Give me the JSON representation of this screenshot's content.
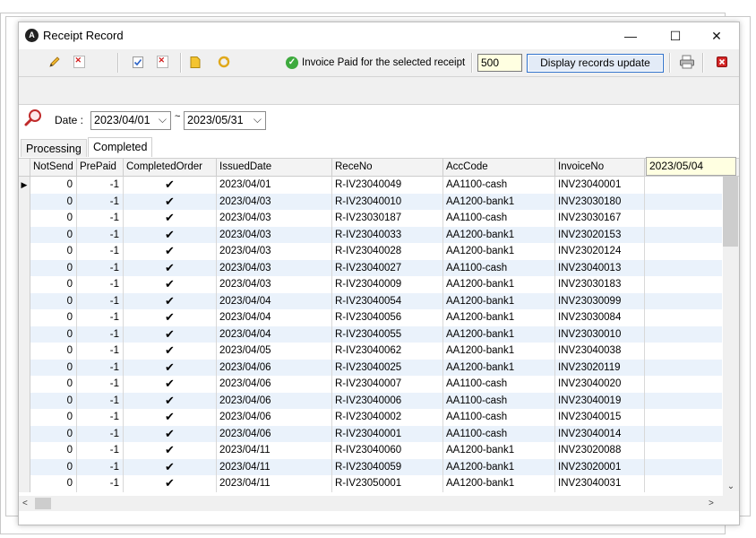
{
  "window": {
    "title": "Receipt Record",
    "app_icon_text": "A",
    "minimize_glyph": "—",
    "maximize_glyph": "☐",
    "close_glyph": "✕"
  },
  "toolbar": {
    "status_text": "Invoice Paid for the selected receipt",
    "record_count": "500",
    "update_button": "Display records update",
    "icons": [
      "pencil-icon",
      "delete-icon",
      "check-icon",
      "delete-icon",
      "note-icon",
      "refresh-icon",
      "printer-icon",
      "close-icon"
    ]
  },
  "filter": {
    "date_label": "Date :",
    "from_date": "2023/04/01",
    "to_date": "2023/05/31",
    "tilde": "~"
  },
  "tabs": [
    {
      "label": "Processing"
    },
    {
      "label": "Completed"
    }
  ],
  "grid": {
    "columns": [
      "NotSend",
      "PrePaid",
      "CompletedOrder",
      "IssuedDate",
      "ReceNo",
      "AccCode",
      "InvoiceNo"
    ],
    "check_glyph": "✔",
    "row_pointer": "▶",
    "rows": [
      [
        "0",
        "-1",
        "✔",
        "2023/04/01",
        "R-IV23040049",
        "AA1100-cash",
        "INV23040001"
      ],
      [
        "0",
        "-1",
        "✔",
        "2023/04/03",
        "R-IV23040010",
        "AA1200-bank1",
        "INV23030180"
      ],
      [
        "0",
        "-1",
        "✔",
        "2023/04/03",
        "R-IV23030187",
        "AA1100-cash",
        "INV23030167"
      ],
      [
        "0",
        "-1",
        "✔",
        "2023/04/03",
        "R-IV23040033",
        "AA1200-bank1",
        "INV23020153"
      ],
      [
        "0",
        "-1",
        "✔",
        "2023/04/03",
        "R-IV23040028",
        "AA1200-bank1",
        "INV23020124"
      ],
      [
        "0",
        "-1",
        "✔",
        "2023/04/03",
        "R-IV23040027",
        "AA1100-cash",
        "INV23040013"
      ],
      [
        "0",
        "-1",
        "✔",
        "2023/04/03",
        "R-IV23040009",
        "AA1200-bank1",
        "INV23030183"
      ],
      [
        "0",
        "-1",
        "✔",
        "2023/04/04",
        "R-IV23040054",
        "AA1200-bank1",
        "INV23030099"
      ],
      [
        "0",
        "-1",
        "✔",
        "2023/04/04",
        "R-IV23040056",
        "AA1200-bank1",
        "INV23030084"
      ],
      [
        "0",
        "-1",
        "✔",
        "2023/04/04",
        "R-IV23040055",
        "AA1200-bank1",
        "INV23030010"
      ],
      [
        "0",
        "-1",
        "✔",
        "2023/04/05",
        "R-IV23040062",
        "AA1200-bank1",
        "INV23040038"
      ],
      [
        "0",
        "-1",
        "✔",
        "2023/04/06",
        "R-IV23040025",
        "AA1200-bank1",
        "INV23020119"
      ],
      [
        "0",
        "-1",
        "✔",
        "2023/04/06",
        "R-IV23040007",
        "AA1100-cash",
        "INV23040020"
      ],
      [
        "0",
        "-1",
        "✔",
        "2023/04/06",
        "R-IV23040006",
        "AA1100-cash",
        "INV23040019"
      ],
      [
        "0",
        "-1",
        "✔",
        "2023/04/06",
        "R-IV23040002",
        "AA1100-cash",
        "INV23040015"
      ],
      [
        "0",
        "-1",
        "✔",
        "2023/04/06",
        "R-IV23040001",
        "AA1100-cash",
        "INV23040014"
      ],
      [
        "0",
        "-1",
        "✔",
        "2023/04/11",
        "R-IV23040060",
        "AA1200-bank1",
        "INV23020088"
      ],
      [
        "0",
        "-1",
        "✔",
        "2023/04/11",
        "R-IV23040059",
        "AA1200-bank1",
        "INV23020001"
      ],
      [
        "0",
        "-1",
        "✔",
        "2023/04/11",
        "R-IV23050001",
        "AA1200-bank1",
        "INV23040031"
      ]
    ]
  },
  "tooltip": "2023/05/04",
  "colors": {
    "status_ok": "#3eaa3e",
    "alt_row": "#eaf2fb",
    "tooltip_bg": "#ffffe1",
    "accent_border": "#2f71cc"
  }
}
